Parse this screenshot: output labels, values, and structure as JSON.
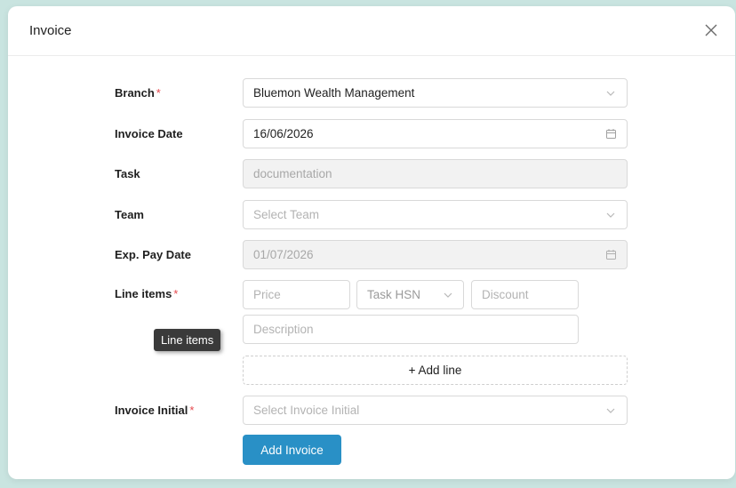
{
  "modal": {
    "title": "Invoice",
    "close_icon": "close-icon"
  },
  "form": {
    "branch": {
      "label": "Branch",
      "required": "*",
      "value": "Bluemon Wealth Management",
      "icon": "chevron-down-icon"
    },
    "invoice_date": {
      "label": "Invoice Date",
      "value": "16/06/2026",
      "icon": "calendar-icon"
    },
    "task": {
      "label": "Task",
      "value": "documentation",
      "disabled": true
    },
    "team": {
      "label": "Team",
      "placeholder": "Select Team",
      "icon": "chevron-down-icon"
    },
    "exp_pay_date": {
      "label": "Exp. Pay Date",
      "value": "01/07/2026",
      "disabled": true,
      "icon": "calendar-icon"
    },
    "line_items": {
      "label": "Line items",
      "required": "*",
      "price_placeholder": "Price",
      "task_hsn_placeholder": "Task HSN",
      "discount_placeholder": "Discount",
      "description_placeholder": "Description",
      "add_line_label": "+ Add line",
      "tooltip": "Line items"
    },
    "invoice_initial": {
      "label": "Invoice Initial",
      "required": "*",
      "placeholder": "Select Invoice Initial",
      "icon": "chevron-down-icon"
    },
    "submit_label": "Add Invoice"
  },
  "colors": {
    "primary": "#2990c6",
    "required": "#e5484d",
    "backdrop": "#c9e4e0"
  }
}
